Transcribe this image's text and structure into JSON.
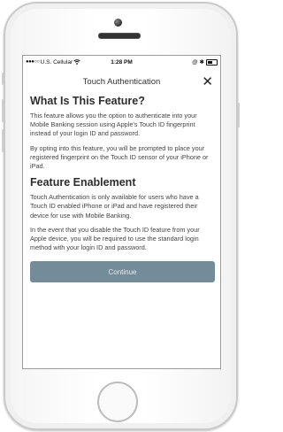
{
  "status_bar": {
    "signal": "●●●○○",
    "carrier": "U.S. Cellular",
    "wifi_icon": "wifi-icon",
    "time": "1:28 PM",
    "right_icons": "@ ✱"
  },
  "dialog": {
    "title": "Touch Authentication",
    "close": "✕",
    "sections": [
      {
        "heading": "What Is This Feature?",
        "paragraphs": [
          "This feature allows you the option to authenticate into your Mobile Banking session using Apple's Touch ID fingerprint instead of your login ID and password.",
          "By opting into this feature, you will be prompted to place your registered fingerprint on the Touch ID sensor of your iPhone or iPad."
        ]
      },
      {
        "heading": "Feature Enablement",
        "paragraphs": [
          "Touch Authentication is only available for users who have a Touch ID enabled iPhone or iPad and have registered their device for use with Mobile Banking.",
          "In the event that you disable the Touch ID feature from your Apple device, you will be required to use the standard login method with your login ID and password."
        ]
      }
    ],
    "continue_label": "Continue"
  },
  "colors": {
    "button_bg": "#748b9a",
    "button_text": "#e3eaee"
  }
}
